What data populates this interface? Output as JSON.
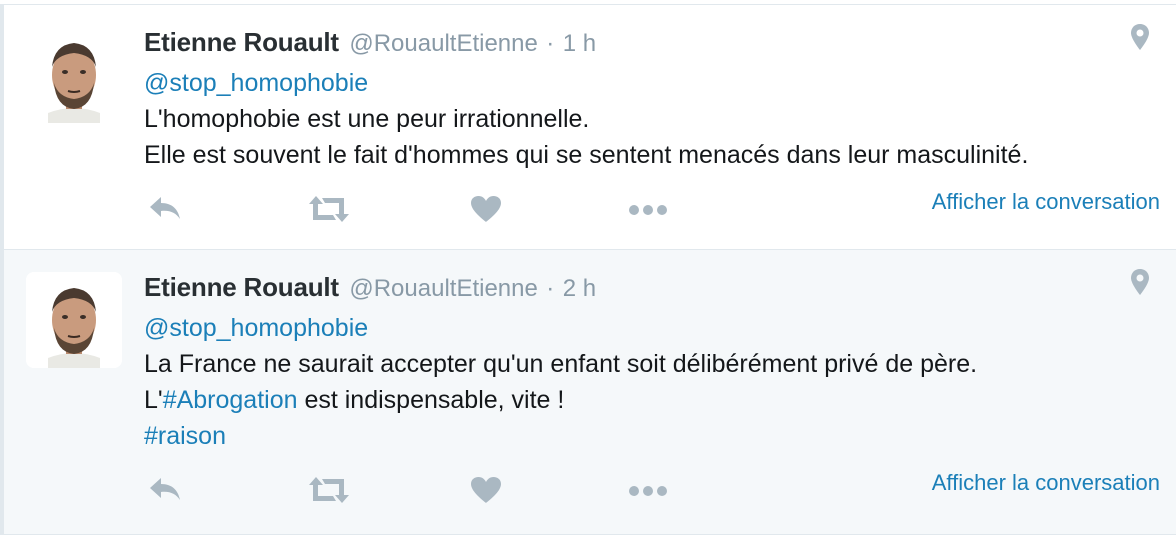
{
  "tweets": [
    {
      "name": "Etienne Rouault",
      "handle": "@RouaultEtienne",
      "separator": "·",
      "time": "1 h",
      "mention": "@stop_homophobie",
      "lines": [
        "L'homophobie est une peur irrationnelle.",
        "Elle est souvent le fait d'hommes qui se sentent menacés dans leur masculinité."
      ],
      "show_conversation": "Afficher la conversation"
    },
    {
      "name": "Etienne Rouault",
      "handle": "@RouaultEtienne",
      "separator": "·",
      "time": "2 h",
      "mention": "@stop_homophobie",
      "line1": "La France ne saurait accepter qu'un enfant soit délibérément privé de père.",
      "line2_prefix": "L'",
      "line2_hashtag": "#Abrogation",
      "line2_suffix": " est indispensable, vite !",
      "line3_hashtag": "#raison",
      "show_conversation": "Afficher la conversation"
    }
  ],
  "colors": {
    "link": "#1b7fb8",
    "meta": "#8899a6",
    "icon": "#aab8c2",
    "alt_background": "#f5f8fa"
  },
  "icons": [
    "location-pin-icon",
    "reply-icon",
    "retweet-icon",
    "like-icon",
    "more-icon"
  ]
}
